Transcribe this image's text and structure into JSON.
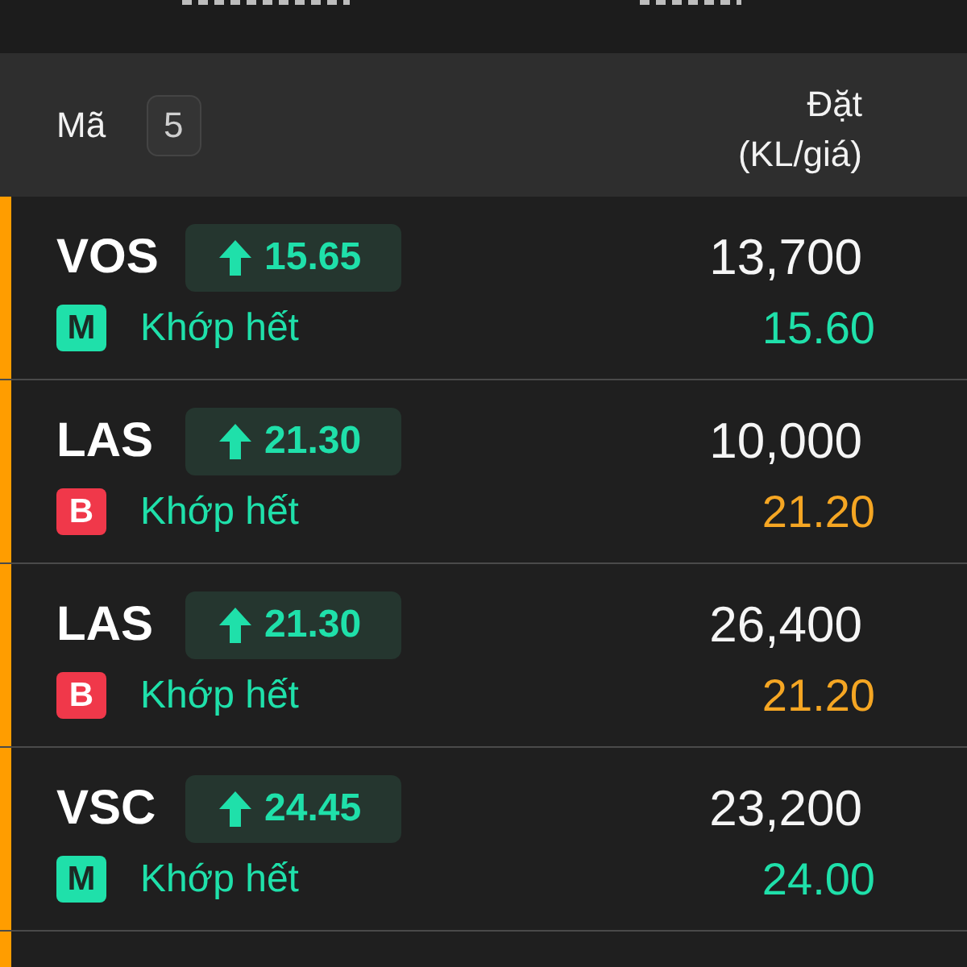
{
  "header": {
    "symbol_label": "Mã",
    "count": "5",
    "order_label": "Đặt",
    "order_sublabel": "(KL/giá)"
  },
  "rows": [
    {
      "symbol": "VOS",
      "rising": true,
      "market_price": "15.65",
      "kind": "buy",
      "side": "M",
      "status": "Khớp hết",
      "quantity": "13,700",
      "price": "15.60",
      "highlighted": true
    },
    {
      "symbol": "LAS",
      "rising": true,
      "market_price": "21.30",
      "kind": "sell",
      "side": "B",
      "status": "Khớp hết",
      "quantity": "10,000",
      "price": "21.20",
      "highlighted": true
    },
    {
      "symbol": "LAS",
      "rising": true,
      "market_price": "21.30",
      "kind": "sell",
      "side": "B",
      "status": "Khớp hết",
      "quantity": "26,400",
      "price": "21.20",
      "highlighted": true
    },
    {
      "symbol": "VSC",
      "rising": true,
      "market_price": "24.45",
      "kind": "buy",
      "side": "M",
      "status": "Khớp hết",
      "quantity": "23,200",
      "price": "24.00",
      "highlighted": true
    },
    {
      "highlighted": true
    }
  ]
}
